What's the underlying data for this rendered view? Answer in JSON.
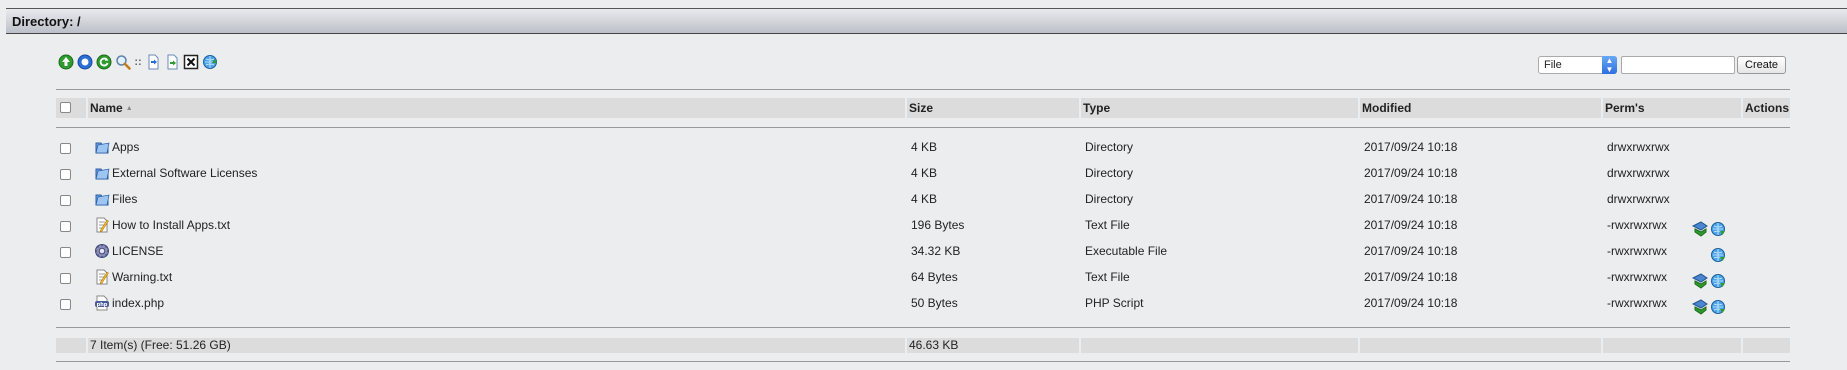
{
  "title": "Directory: /",
  "toolbar": {
    "icons": [
      "up-arrow-icon",
      "home-icon",
      "refresh-icon",
      "search-icon",
      "separator-icon",
      "copy-icon",
      "move-icon",
      "delete-icon",
      "upload-icon"
    ],
    "separator": "::"
  },
  "create": {
    "type_selected": "File",
    "name_value": "",
    "button_label": "Create"
  },
  "columns": {
    "name": "Name",
    "size": "Size",
    "type": "Type",
    "modified": "Modified",
    "perms": "Perm's",
    "actions": "Actions"
  },
  "rows": [
    {
      "name": "Apps",
      "size": "4 KB",
      "type": "Directory",
      "modified": "2017/09/24 10:18",
      "perms": "drwxrwxrwx",
      "icon": "folder-icon",
      "actions": []
    },
    {
      "name": "External Software Licenses",
      "size": "4 KB",
      "type": "Directory",
      "modified": "2017/09/24 10:18",
      "perms": "drwxrwxrwx",
      "icon": "folder-icon",
      "actions": []
    },
    {
      "name": "Files",
      "size": "4 KB",
      "type": "Directory",
      "modified": "2017/09/24 10:18",
      "perms": "drwxrwxrwx",
      "icon": "folder-icon",
      "actions": []
    },
    {
      "name": "How to Install Apps.txt",
      "size": "196 Bytes",
      "type": "Text File",
      "modified": "2017/09/24 10:18",
      "perms": "-rwxrwxrwx",
      "icon": "text-file-icon",
      "actions": [
        "edit-icon",
        "download-icon"
      ]
    },
    {
      "name": "LICENSE",
      "size": "34.32 KB",
      "type": "Executable File",
      "modified": "2017/09/24 10:18",
      "perms": "-rwxrwxrwx",
      "icon": "executable-icon",
      "actions": [
        "download-icon"
      ]
    },
    {
      "name": "Warning.txt",
      "size": "64 Bytes",
      "type": "Text File",
      "modified": "2017/09/24 10:18",
      "perms": "-rwxrwxrwx",
      "icon": "text-file-icon",
      "actions": [
        "edit-icon",
        "download-icon"
      ]
    },
    {
      "name": "index.php",
      "size": "50 Bytes",
      "type": "PHP Script",
      "modified": "2017/09/24 10:18",
      "perms": "-rwxrwxrwx",
      "icon": "php-file-icon",
      "actions": [
        "edit-icon",
        "download-icon"
      ]
    }
  ],
  "footer": {
    "summary": "7 Item(s) (Free: 51.26 GB)",
    "total_size": "46.63 KB"
  }
}
